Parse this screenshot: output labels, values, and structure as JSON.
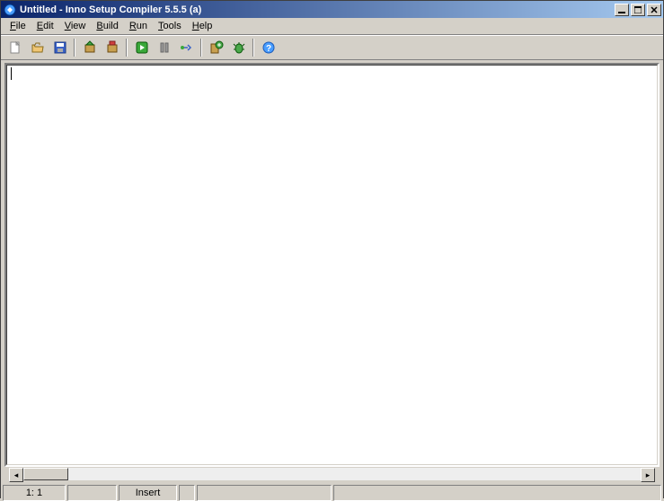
{
  "titlebar": {
    "title": "Untitled - Inno Setup Compiler 5.5.5 (a)"
  },
  "menubar": {
    "items": [
      "File",
      "Edit",
      "View",
      "Build",
      "Run",
      "Tools",
      "Help"
    ]
  },
  "toolbar": {
    "icons": [
      "new",
      "open",
      "save",
      "compile",
      "stop-compile",
      "run",
      "pause",
      "step",
      "target-setup",
      "debug",
      "help"
    ]
  },
  "editor": {
    "content": ""
  },
  "statusbar": {
    "cursor_pos": "1:   1",
    "insert_mode": "Insert"
  }
}
